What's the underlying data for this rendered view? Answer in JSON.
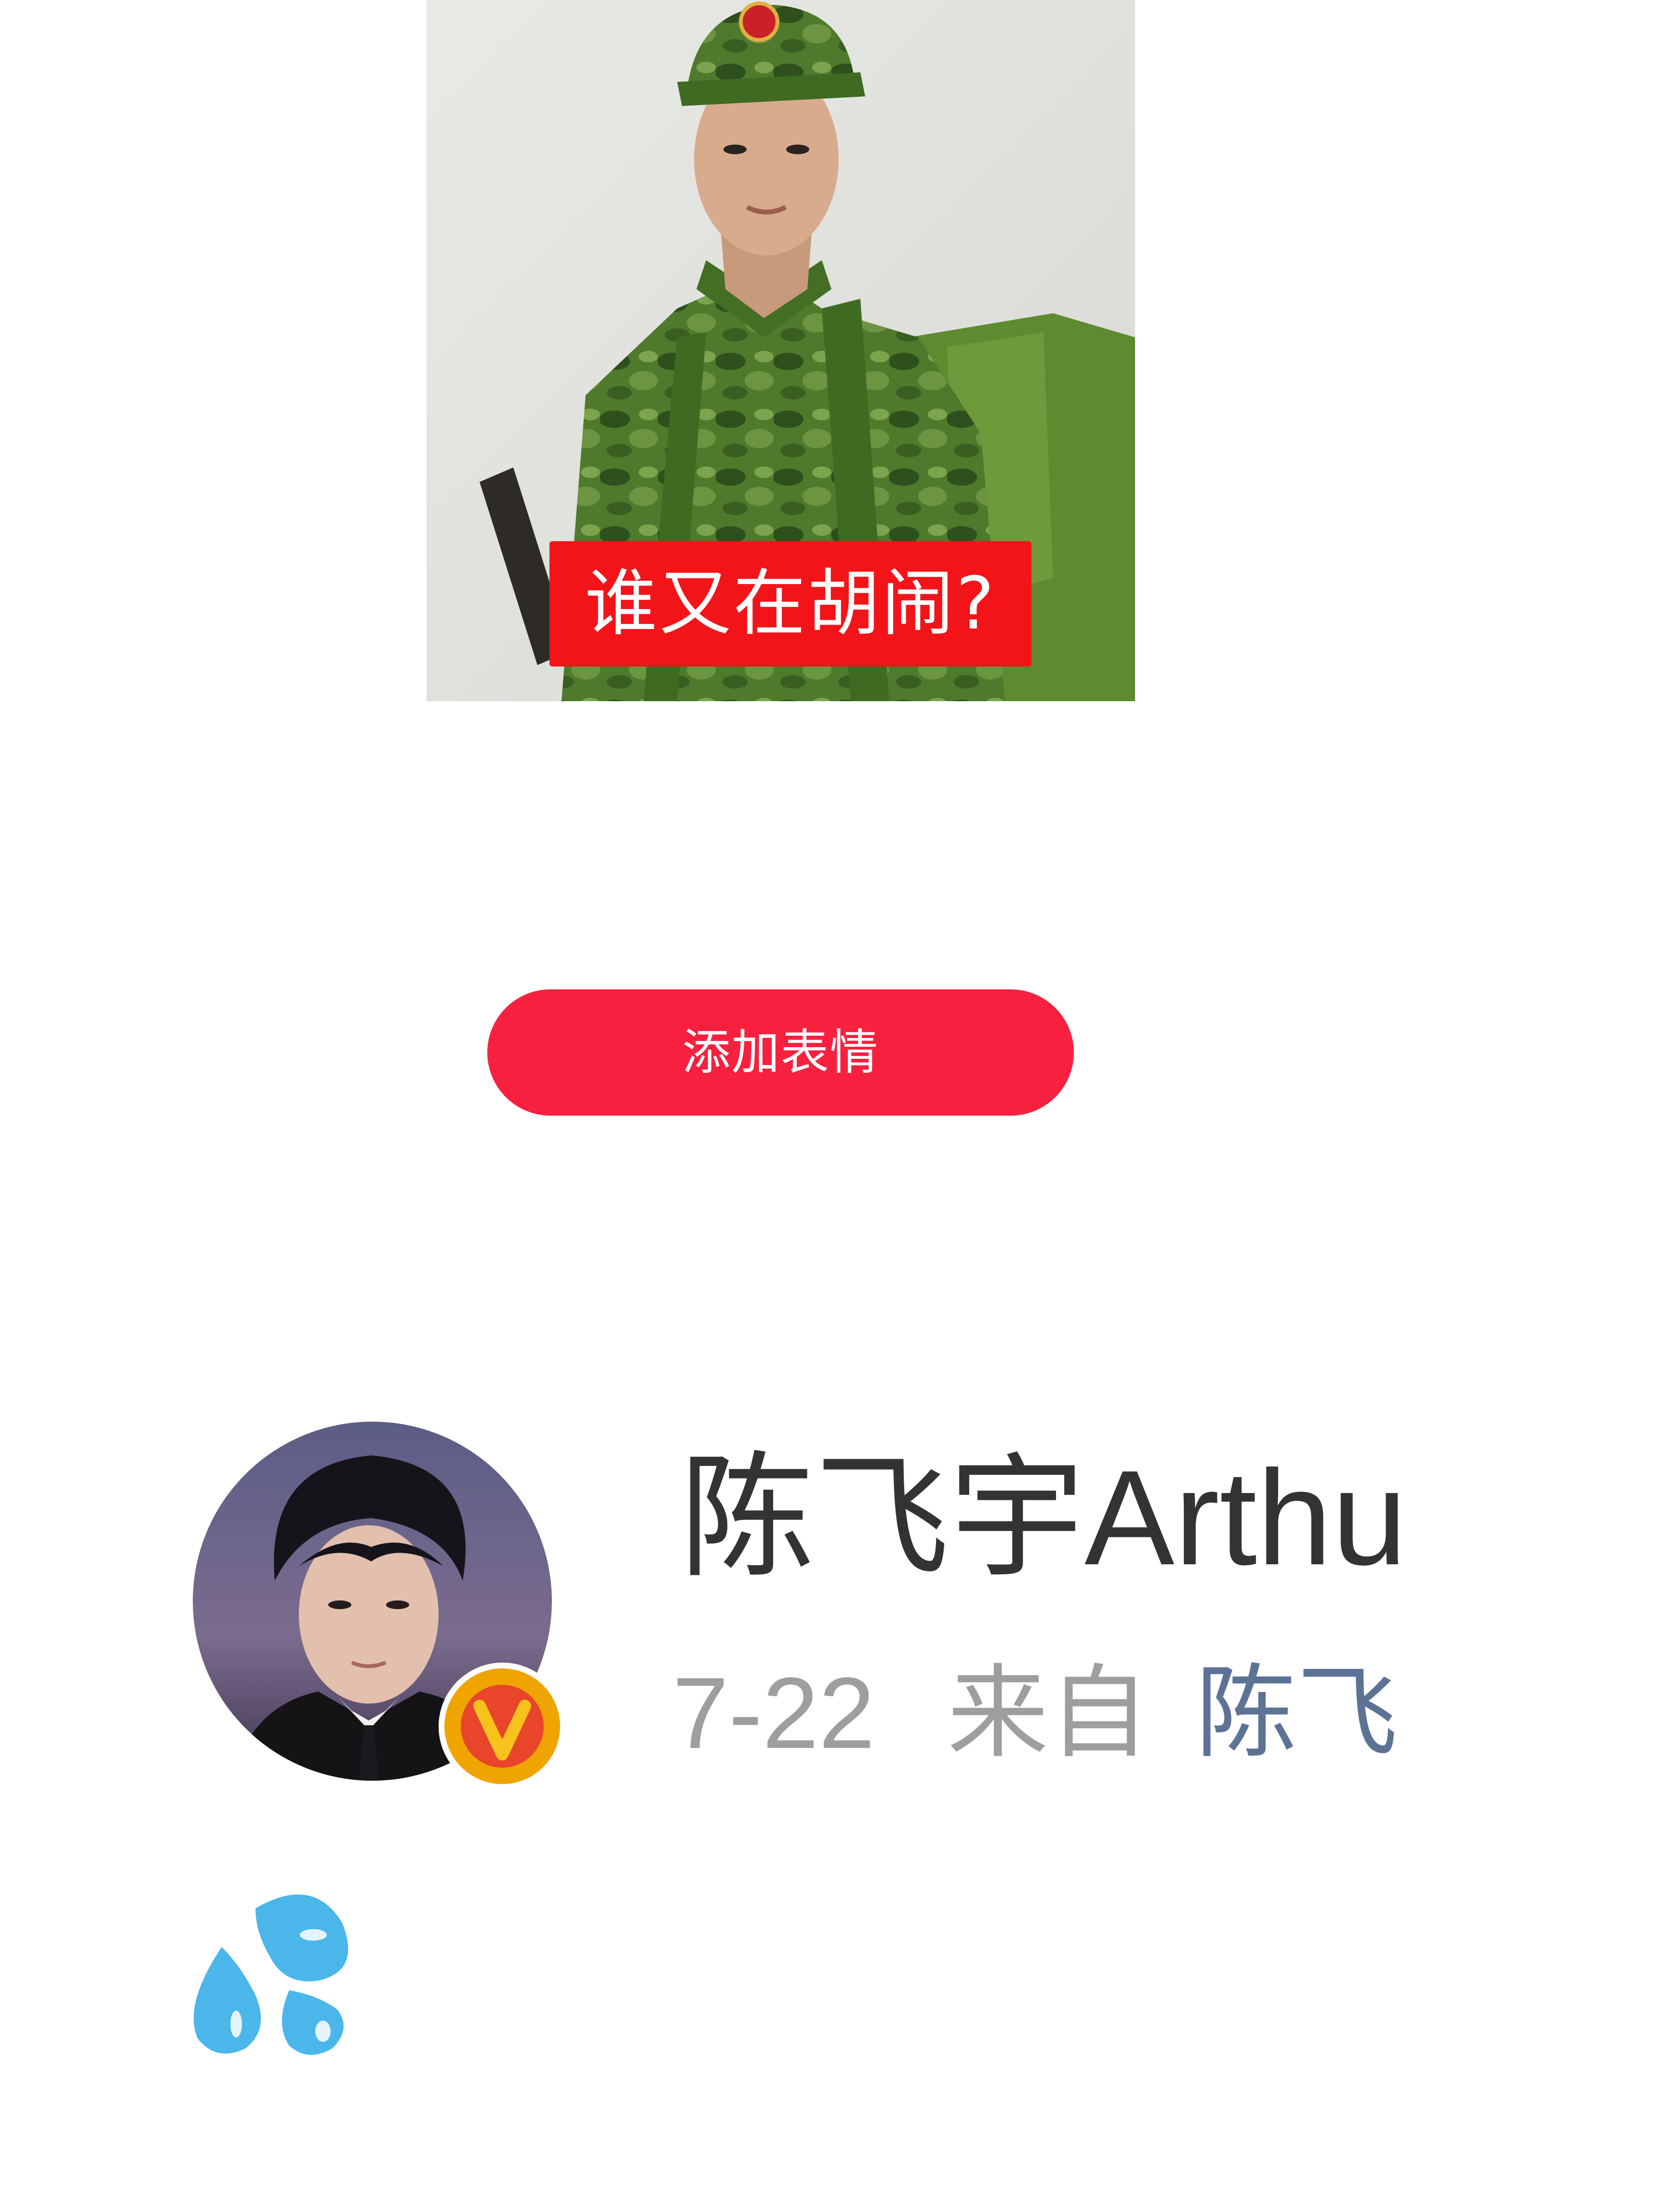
{
  "sticker": {
    "caption": "谁又在胡闹?",
    "caption_color": "#f3141a"
  },
  "add_sticker_button": {
    "label": "添加表情",
    "color": "#f7213f"
  },
  "post": {
    "username": "陈飞宇Arthu",
    "date": "7-22",
    "from_label": "来自",
    "source": "陈飞",
    "source_color": "#5d7396",
    "verified_badge_letter": "V",
    "verified_badge_color": "#f0a400"
  },
  "emoji": {
    "icon": "sweat-drops-icon",
    "color": "#4ab6ea"
  }
}
